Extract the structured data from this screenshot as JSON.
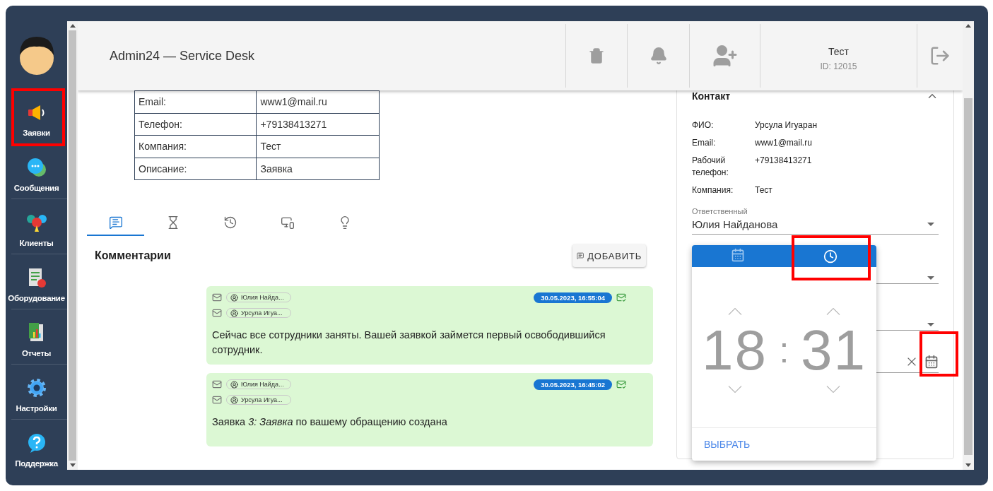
{
  "sidebar": {
    "items": [
      {
        "kind": "requests",
        "label": "Заявки",
        "highlighted": true
      },
      {
        "kind": "messages",
        "label": "Сообщения",
        "highlighted": false
      },
      {
        "kind": "clients",
        "label": "Клиенты",
        "highlighted": false
      },
      {
        "kind": "equipment",
        "label": "Оборудование",
        "highlighted": false
      },
      {
        "kind": "reports",
        "label": "Отчеты",
        "highlighted": false
      },
      {
        "kind": "settings",
        "label": "Настройки",
        "highlighted": false
      },
      {
        "kind": "support",
        "label": "Поддержка",
        "highlighted": false
      }
    ]
  },
  "header": {
    "title": "Admin24 — Service Desk",
    "user": {
      "name": "Тест",
      "id": "ID: 12015"
    }
  },
  "details_table": {
    "rows": [
      {
        "label": "Email:",
        "value": "www1@mail.ru"
      },
      {
        "label": "Телефон:",
        "value": "+79138413271"
      },
      {
        "label": "Компания:",
        "value": "Тест"
      },
      {
        "label": "Описание:",
        "value": "Заявка"
      }
    ]
  },
  "tabs": [
    {
      "kind": "comments",
      "selected": true
    },
    {
      "kind": "timer",
      "selected": false
    },
    {
      "kind": "history",
      "selected": false
    },
    {
      "kind": "devices",
      "selected": false
    },
    {
      "kind": "ideas",
      "selected": false
    }
  ],
  "comments": {
    "title": "Комментарии",
    "add_button": "ДОБАВИТЬ",
    "messages": [
      {
        "from": "Юлия Найда...",
        "to": "Урсула Игуа...",
        "time": "30.05.2023, 16:55:04",
        "text": "Сейчас все сотрудники заняты. Вашей заявкой займется первый освободившийся сотрудник."
      },
      {
        "from": "Юлия Найда...",
        "to": "Урсула Игуа...",
        "time": "30.05.2023, 16:45:02",
        "text": "Заявка *3: Заявка* по вашему обращению создана"
      }
    ]
  },
  "contact": {
    "title": "Контакт",
    "expanded": true,
    "fields": [
      {
        "label": "ФИО:",
        "value": "Урсула Игуаран"
      },
      {
        "label": "Email:",
        "value": "www1@mail.ru"
      },
      {
        "label": "Рабочий телефон:",
        "value": "+79138413271"
      },
      {
        "label": "Компания:",
        "value": "Тест"
      }
    ]
  },
  "assignee": {
    "label": "Ответственный",
    "value": "Юлия Найданова"
  },
  "date_field": {
    "highlighted": true
  },
  "picker": {
    "tabs": [
      {
        "kind": "date",
        "selected": false,
        "highlighted": false
      },
      {
        "kind": "time",
        "selected": true,
        "highlighted": true
      }
    ],
    "hours": "18",
    "separator": ":",
    "minutes": "31",
    "action": "ВЫБРАТЬ"
  }
}
